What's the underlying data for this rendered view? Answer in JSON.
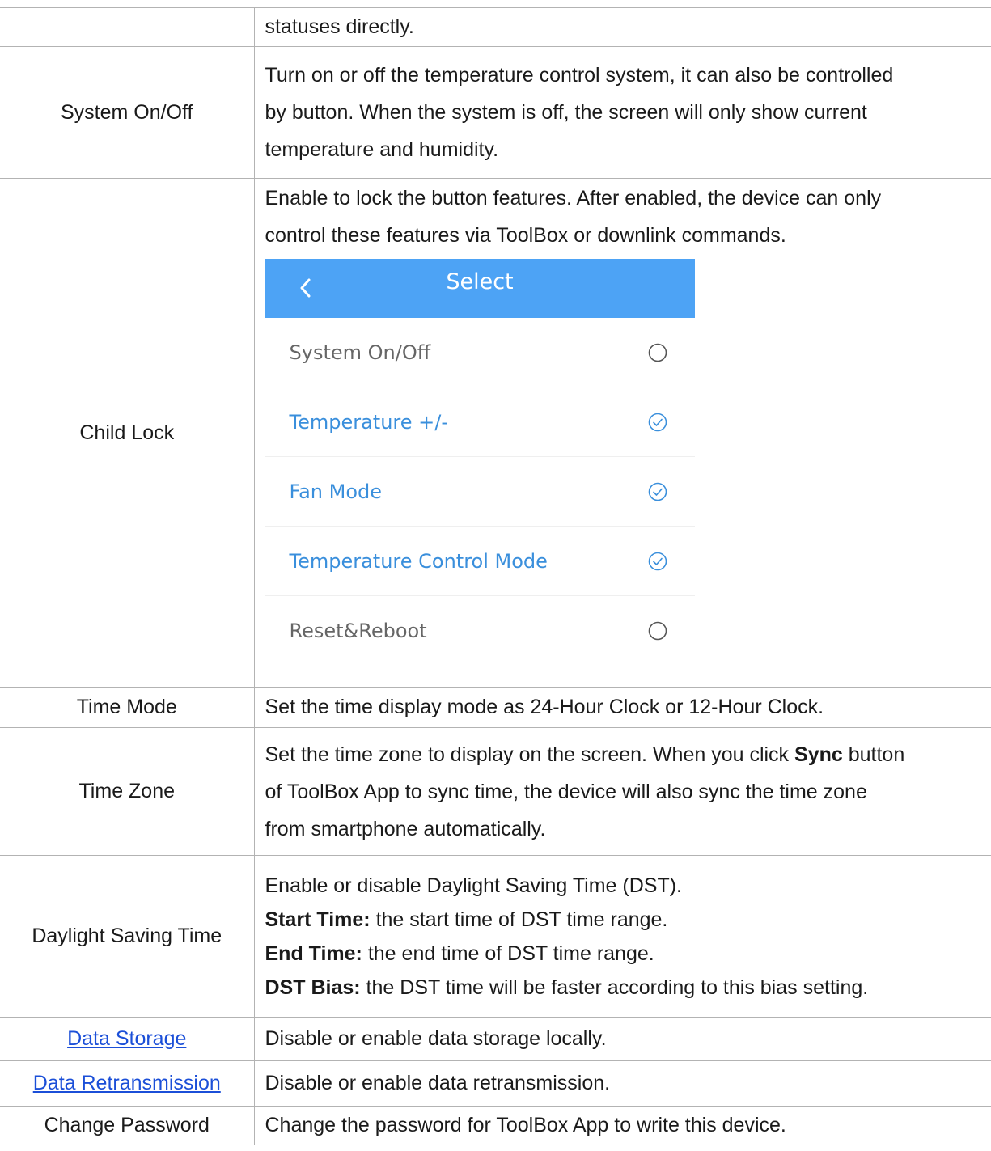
{
  "rows": [
    {
      "name": "",
      "desc": [
        "statuses directly."
      ]
    },
    {
      "name": "System On/Off",
      "desc": [
        "Turn on or off the temperature control system, it can also be controlled",
        "by button. When the system is off, the screen will only show current",
        "temperature and humidity."
      ]
    },
    {
      "name": "Child Lock",
      "desc": [
        "Enable to lock the button features. After enabled, the device can only",
        "control these features via ToolBox or downlink commands."
      ]
    },
    {
      "name": "Time Mode",
      "desc": [
        "Set the time display mode as 24-Hour Clock or 12-Hour Clock."
      ]
    },
    {
      "name": "Time Zone",
      "desc_prefix": "Set the time zone to display on the screen. When you click ",
      "desc_bold": "Sync",
      "desc_suffix": " button",
      "desc_rest": [
        "of ToolBox App to sync time, the device will also sync the time zone",
        "from smartphone automatically."
      ]
    },
    {
      "name": "Daylight Saving Time",
      "intro": "Enable or disable Daylight Saving Time (DST).",
      "items": [
        {
          "term": "Start Time:",
          "text": " the start time of DST time range."
        },
        {
          "term": "End Time:",
          "text": " the end time of DST time range."
        },
        {
          "term": "DST Bias:",
          "text": " the DST time will be faster according to this bias setting."
        }
      ]
    },
    {
      "name": "Data Storage",
      "desc": [
        "Disable or enable data storage locally."
      ]
    },
    {
      "name": "Data Retransmission",
      "desc": [
        "Disable or enable data retransmission."
      ]
    },
    {
      "name": "Change Password",
      "desc": [
        "Change the password for ToolBox App to write this device."
      ]
    }
  ],
  "app_screen": {
    "title": "Select",
    "back_icon": "chevron-left-icon",
    "header_color": "#4da3f5",
    "selected_color": "#3a8fdc",
    "options": [
      {
        "label": "System On/Off",
        "checked": false
      },
      {
        "label": "Temperature +/-",
        "checked": true
      },
      {
        "label": "Fan Mode",
        "checked": true
      },
      {
        "label": "Temperature Control Mode",
        "checked": true
      },
      {
        "label": "Reset&Reboot",
        "checked": false
      }
    ]
  }
}
